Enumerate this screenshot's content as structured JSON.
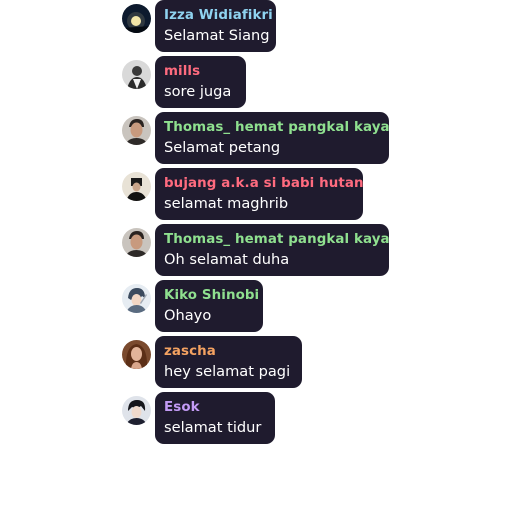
{
  "messages": [
    {
      "username": "Izza Widiafikri",
      "text": "Selamat Siang",
      "name_color": "#8fd3f0",
      "avatar": "night-sky-avatar"
    },
    {
      "username": "mills",
      "text": "sore juga",
      "name_color": "#ff6b7f",
      "avatar": "person-grayscale-avatar"
    },
    {
      "username": "Thomas_ hemat pangkal kaya",
      "text": "Selamat petang",
      "name_color": "#8fe08f",
      "avatar": "man-portrait-avatar"
    },
    {
      "username": "bujang a.k.a si babi hutan",
      "text": "selamat maghrib",
      "name_color": "#ff6b7f",
      "avatar": "dark-figure-avatar"
    },
    {
      "username": "Thomas_ hemat pangkal kaya",
      "text": "Oh selamat duha",
      "name_color": "#8fe08f",
      "avatar": "man-portrait-avatar"
    },
    {
      "username": "Kiko Shinobi",
      "text": "Ohayo",
      "name_color": "#8fe08f",
      "avatar": "anime-character-avatar"
    },
    {
      "username": "zascha",
      "text": "hey selamat pagi",
      "name_color": "#f4a261",
      "avatar": "woman-portrait-avatar"
    },
    {
      "username": "Esok",
      "text": "selamat tidur",
      "name_color": "#c39bf5",
      "avatar": "dark-hair-avatar"
    }
  ]
}
